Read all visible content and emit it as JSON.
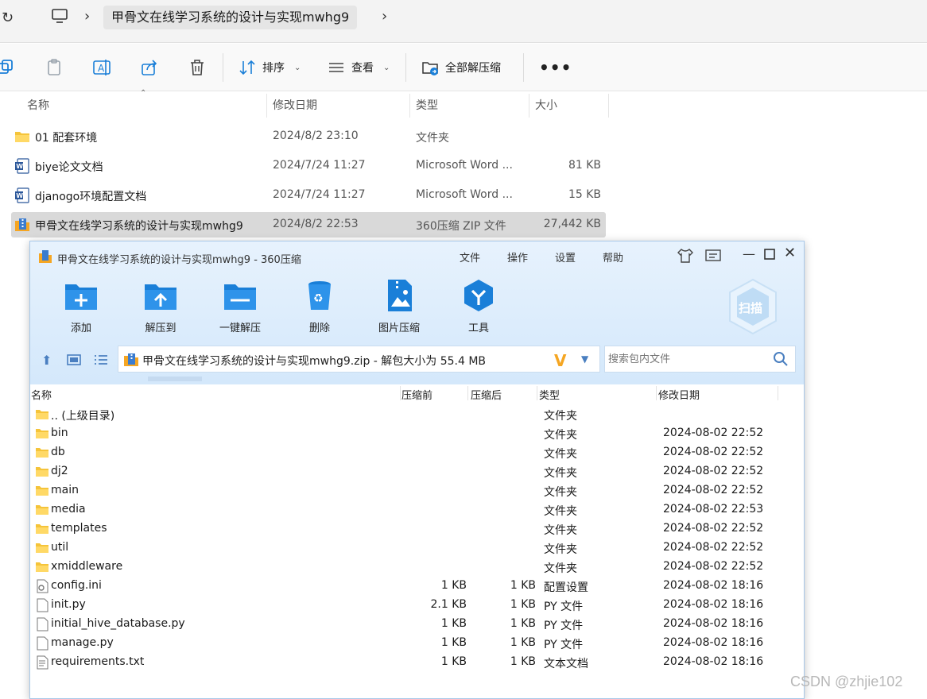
{
  "explorer": {
    "breadcrumb": "甲骨文在线学习系统的设计与实现mwhg9",
    "commands": {
      "sort": "排序",
      "view": "查看",
      "extract_all": "全部解压缩",
      "more": "•••"
    },
    "columns": {
      "name": "名称",
      "date": "修改日期",
      "type": "类型",
      "size": "大小"
    },
    "files": [
      {
        "name": "01 配套环境",
        "date": "2024/8/2 23:10",
        "type": "文件夹",
        "size": "",
        "icon": "folder-icon"
      },
      {
        "name": "biye论文文档",
        "date": "2024/7/24 11:27",
        "type": "Microsoft Word ...",
        "size": "81 KB",
        "icon": "word-doc-icon"
      },
      {
        "name": "djanogo环境配置文档",
        "date": "2024/7/24 11:27",
        "type": "Microsoft Word ...",
        "size": "15 KB",
        "icon": "word-doc-icon"
      },
      {
        "name": "甲骨文在线学习系统的设计与实现mwhg9",
        "date": "2024/8/2 22:53",
        "type": "360压缩 ZIP 文件",
        "size": "27,442 KB",
        "icon": "zip-archive-icon"
      }
    ]
  },
  "archive_window": {
    "title": "甲骨文在线学习系统的设计与实现mwhg9 - 360压缩",
    "menu": [
      "文件",
      "操作",
      "设置",
      "帮助"
    ],
    "tools": [
      "添加",
      "解压到",
      "一键解压",
      "删除",
      "图片压缩",
      "工具"
    ],
    "scan_label": "扫描",
    "path": "甲骨文在线学习系统的设计与实现mwhg9.zip - 解包大小为 55.4 MB",
    "search_placeholder": "搜索包内文件",
    "columns": {
      "name": "名称",
      "before": "压缩前",
      "after": "压缩后",
      "type": "类型",
      "date": "修改日期"
    },
    "entries": [
      {
        "name": ".. (上级目录)",
        "before": "",
        "after": "",
        "type": "文件夹",
        "date": ""
      },
      {
        "name": "bin",
        "before": "",
        "after": "",
        "type": "文件夹",
        "date": "2024-08-02 22:52"
      },
      {
        "name": "db",
        "before": "",
        "after": "",
        "type": "文件夹",
        "date": "2024-08-02 22:52"
      },
      {
        "name": "dj2",
        "before": "",
        "after": "",
        "type": "文件夹",
        "date": "2024-08-02 22:52"
      },
      {
        "name": "main",
        "before": "",
        "after": "",
        "type": "文件夹",
        "date": "2024-08-02 22:52"
      },
      {
        "name": "media",
        "before": "",
        "after": "",
        "type": "文件夹",
        "date": "2024-08-02 22:53"
      },
      {
        "name": "templates",
        "before": "",
        "after": "",
        "type": "文件夹",
        "date": "2024-08-02 22:52"
      },
      {
        "name": "util",
        "before": "",
        "after": "",
        "type": "文件夹",
        "date": "2024-08-02 22:52"
      },
      {
        "name": "xmiddleware",
        "before": "",
        "after": "",
        "type": "文件夹",
        "date": "2024-08-02 22:52"
      },
      {
        "name": "config.ini",
        "before": "1 KB",
        "after": "1 KB",
        "type": "配置设置",
        "date": "2024-08-02 18:16"
      },
      {
        "name": "init.py",
        "before": "2.1 KB",
        "after": "1 KB",
        "type": "PY 文件",
        "date": "2024-08-02 18:16"
      },
      {
        "name": "initial_hive_database.py",
        "before": "1 KB",
        "after": "1 KB",
        "type": "PY 文件",
        "date": "2024-08-02 18:16"
      },
      {
        "name": "manage.py",
        "before": "1 KB",
        "after": "1 KB",
        "type": "PY 文件",
        "date": "2024-08-02 18:16"
      },
      {
        "name": "requirements.txt",
        "before": "1 KB",
        "after": "1 KB",
        "type": "文本文档",
        "date": "2024-08-02 18:16"
      }
    ]
  },
  "watermark": "CSDN @zhjie102",
  "colors": {
    "folder": "#f5c43a",
    "accent_blue": "#1a7fd8",
    "selection": "#d9d9d9"
  }
}
